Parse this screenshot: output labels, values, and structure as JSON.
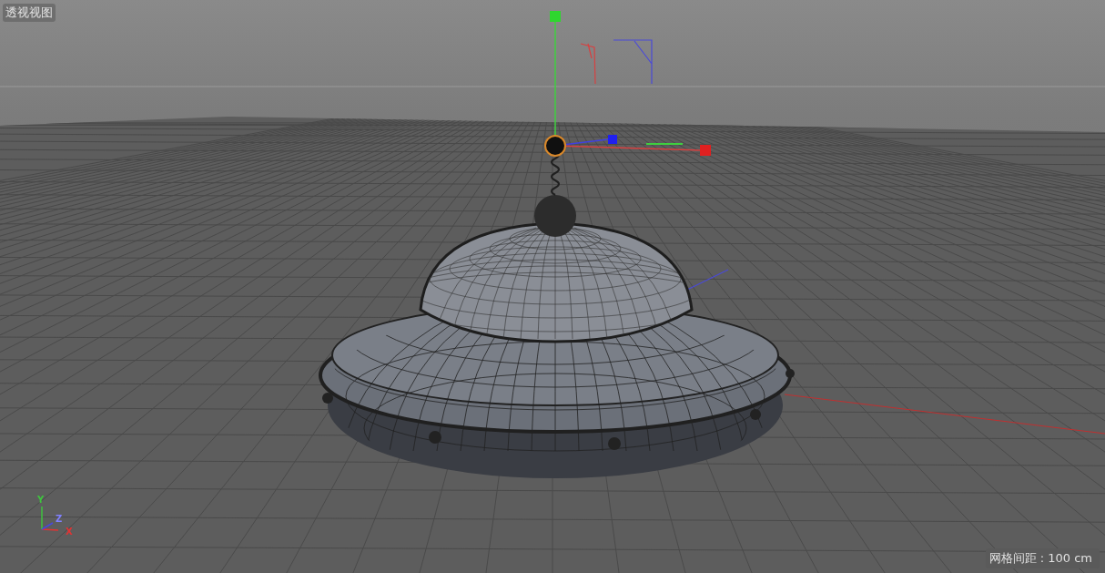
{
  "viewport": {
    "title": "透视视图",
    "grid_spacing": "网格间距 : 100 cm",
    "axis_labels": [
      {
        "text": "Y",
        "color": "#3fc23f"
      },
      {
        "text": "Z",
        "color": "#8080ff"
      },
      {
        "text": "X",
        "color": "#e03434"
      }
    ]
  }
}
